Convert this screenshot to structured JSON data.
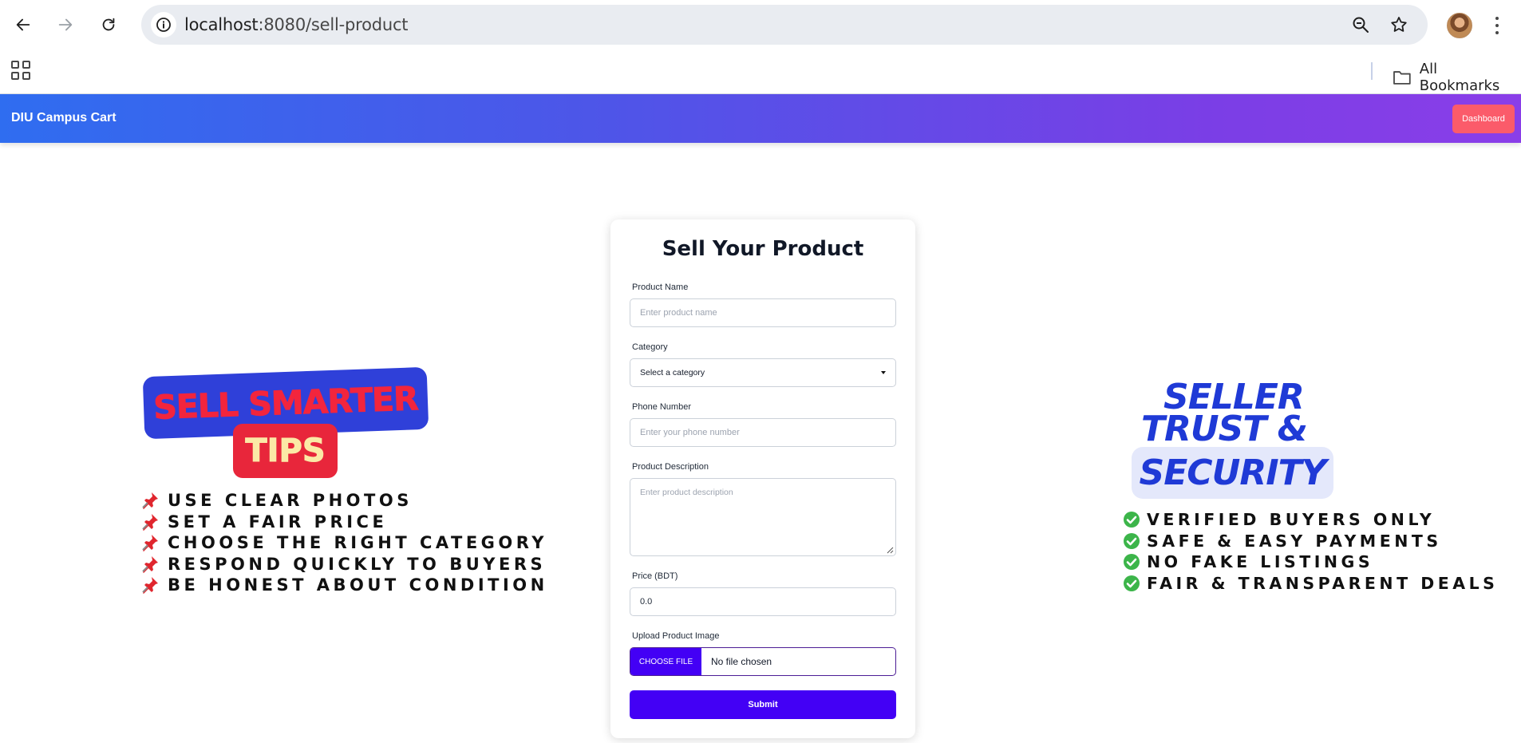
{
  "browser": {
    "url_host": "localhost",
    "url_path": ":8080/sell-product",
    "all_bookmarks_label": "All Bookmarks"
  },
  "nav": {
    "brand": "DIU Campus Cart",
    "dashboard_label": "Dashboard"
  },
  "tips": {
    "title": "SELL SMARTER",
    "subtitle": "TIPS",
    "items": [
      "USE CLEAR PHOTOS",
      "SET A FAIR PRICE",
      "CHOOSE THE RIGHT CATEGORY",
      "RESPOND QUICKLY TO BUYERS",
      "BE HONEST ABOUT CONDITION"
    ]
  },
  "trust": {
    "line1": "SELLER",
    "line2": "TRUST &",
    "line3": "SECURITY",
    "items": [
      "VERIFIED BUYERS ONLY",
      "SAFE & EASY PAYMENTS",
      "NO FAKE LISTINGS",
      "FAIR & TRANSPARENT DEALS"
    ]
  },
  "form": {
    "title": "Sell Your Product",
    "product_name_label": "Product Name",
    "product_name_placeholder": "Enter product name",
    "category_label": "Category",
    "category_selected": "Select a category",
    "phone_label": "Phone Number",
    "phone_placeholder": "Enter your phone number",
    "description_label": "Product Description",
    "description_placeholder": "Enter product description",
    "price_label": "Price (BDT)",
    "price_value": "0.0",
    "image_label": "Upload Product Image",
    "choose_file_label": "CHOOSE FILE",
    "no_file_text": "No file chosen",
    "submit_label": "Submit"
  },
  "colors": {
    "nav_gradient_start": "#2f6df0",
    "nav_gradient_end": "#8a3ee8",
    "dashboard_button": "#fb5b6a",
    "primary_button": "#4300f5",
    "tips_badge": "#2f40d9",
    "tips_red": "#e8263b",
    "trust_blue": "#1f3ad6",
    "check_green": "#3cb54a"
  }
}
